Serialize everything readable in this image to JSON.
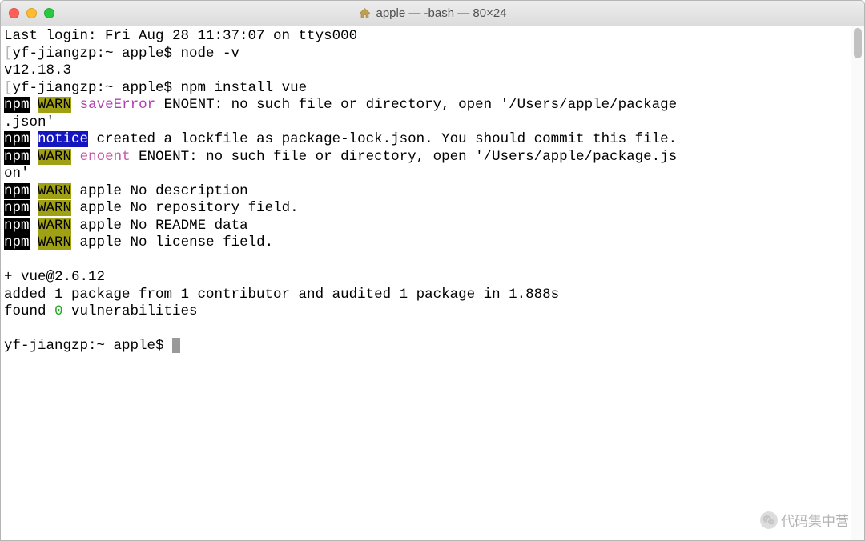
{
  "titlebar": {
    "title": "apple — -bash — 80×24"
  },
  "terminal": {
    "last_login": "Last login: Fri Aug 28 11:37:07 on ttys000",
    "prompt1_bracket_open": "[",
    "prompt1_text": "yf-jiangzp:~ apple$ node -v",
    "prompt1_bracket_close": "]",
    "node_version": "v12.18.3",
    "prompt2_bracket_open": "[",
    "prompt2_text": "yf-jiangzp:~ apple$ npm install vue",
    "prompt2_bracket_close": "]",
    "npm": "npm",
    "warn": "WARN",
    "notice": "notice",
    "saveError": "saveError",
    "enoent_label": "enoent",
    "msg_saveerror_part1": " ENOENT: no such file or directory, open '/Users/apple/package",
    "msg_saveerror_part2": ".json'",
    "msg_notice": " created a lockfile as package-lock.json. You should commit this file.",
    "msg_enoent_part1": " ENOENT: no such file or directory, open '/Users/apple/package.js",
    "msg_enoent_part2": "on'",
    "msg_nodesc": " apple No description",
    "msg_norepo": " apple No repository field.",
    "msg_noreadme": " apple No README data",
    "msg_nolicense": " apple No license field.",
    "plus_vue": "+ vue@2.6.12",
    "added_line": "added 1 package from 1 contributor and audited 1 package in 1.888s",
    "found_prefix": "found ",
    "found_zero": "0",
    "found_suffix": " vulnerabilities",
    "final_prompt": "yf-jiangzp:~ apple$ "
  },
  "watermark": {
    "text": "代码集中营"
  }
}
